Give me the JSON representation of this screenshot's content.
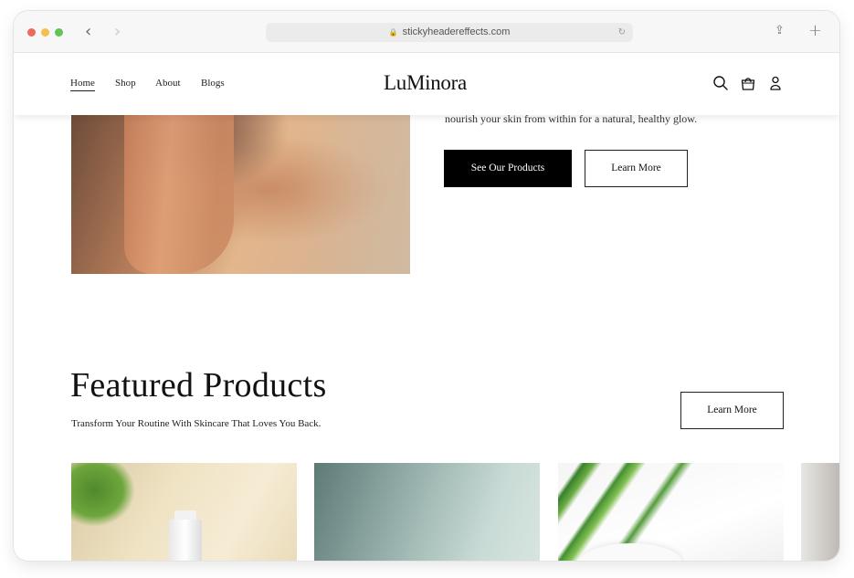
{
  "browser": {
    "url": "stickyheadereffects.com"
  },
  "nav": {
    "items": [
      {
        "label": "Home",
        "active": true
      },
      {
        "label": "Shop",
        "active": false
      },
      {
        "label": "About",
        "active": false
      },
      {
        "label": "Blogs",
        "active": false
      }
    ],
    "logo": "LuMinora",
    "icons": [
      "search-icon",
      "bag-icon",
      "user-icon"
    ]
  },
  "hero": {
    "text": "nourish your skin from within for a natural, healthy glow.",
    "primary_button": "See Our Products",
    "secondary_button": "Learn More"
  },
  "featured": {
    "title": "Featured Products",
    "subtitle": "Transform Your Routine With Skincare That Loves You Back.",
    "button": "Learn More"
  },
  "colors": {
    "primary": "#000000",
    "background": "#ffffff",
    "text": "#111111"
  }
}
